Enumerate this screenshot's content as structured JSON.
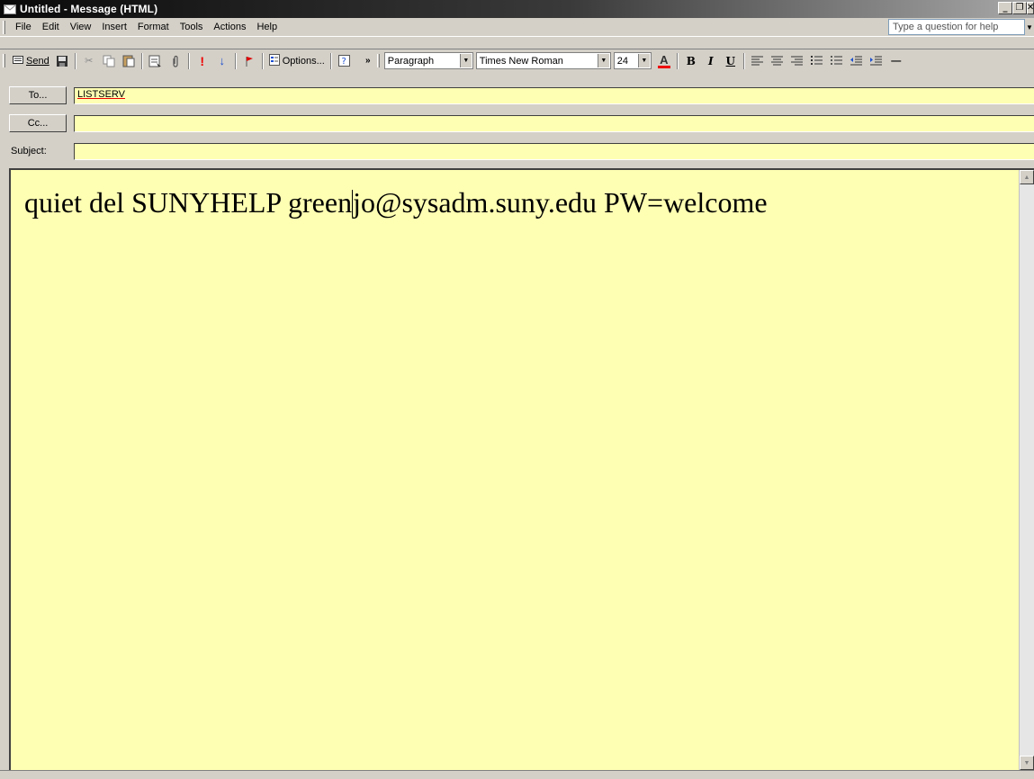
{
  "window": {
    "title": "Untitled - Message (HTML)"
  },
  "menubar": {
    "items": [
      "File",
      "Edit",
      "View",
      "Insert",
      "Format",
      "Tools",
      "Actions",
      "Help"
    ],
    "help_placeholder": "Type a question for help"
  },
  "toolbar": {
    "send_label": "Send",
    "options_label": "Options...",
    "style_value": "Paragraph",
    "font_value": "Times New Roman",
    "size_value": "24"
  },
  "address": {
    "to_label": "To...",
    "to_value": "LISTSERV",
    "cc_label": "Cc...",
    "cc_value": "",
    "subject_label": "Subject:",
    "subject_value": ""
  },
  "body": {
    "text_before_caret": "quiet del SUNYHELP green",
    "text_after_caret": "jo@sysadm.suny.edu PW=welcome"
  },
  "colors": {
    "field_bg": "#ffffb3",
    "chrome": "#d4d0c8"
  }
}
